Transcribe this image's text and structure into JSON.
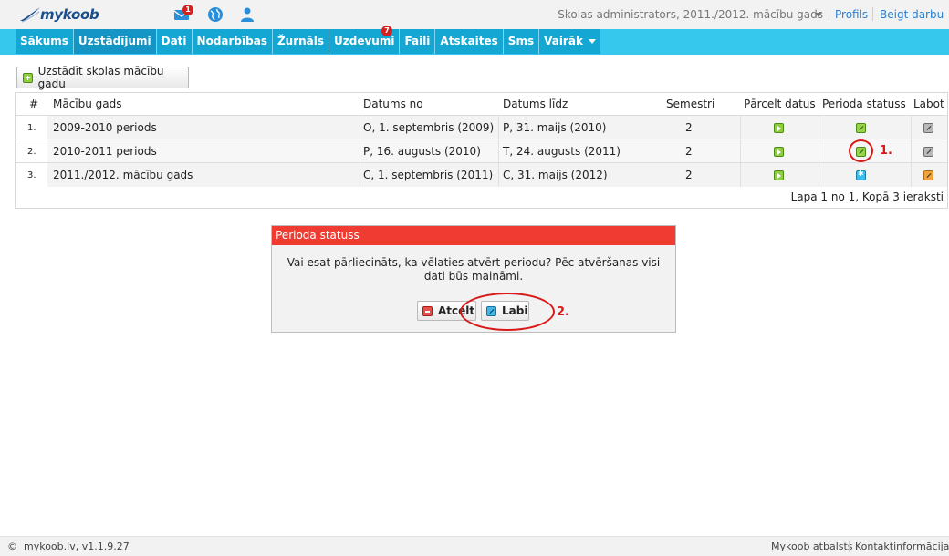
{
  "app": {
    "logo_text": "mykoob",
    "role_label": "Skolas administrators, 2011./2012. mācību gads",
    "links": {
      "profile": "Profils",
      "logout": "Beigt darbu"
    },
    "mail_badge": "1",
    "icons": [
      "envelope-icon",
      "globe-icon",
      "user-icon"
    ]
  },
  "nav": {
    "items": [
      "Sākums",
      "Uzstādījumi",
      "Dati",
      "Nodarbības",
      "Žurnāls",
      "Uzdevumi",
      "Faili",
      "Atskaites",
      "Sms",
      "Vairāk"
    ],
    "active": "Uzstādījumi",
    "files_badge": "7"
  },
  "toolbar": {
    "add_label": "Uzstādīt skolas mācību gadu"
  },
  "table": {
    "headers": [
      "#",
      "Mācību gads",
      "Datums no",
      "Datums līdz",
      "Semestri",
      "Pārcelt datus",
      "Perioda statuss",
      "Labot"
    ],
    "rows": [
      {
        "num": "1.",
        "name": "2009-2010 periods",
        "from": "O, 1. septembris (2009)",
        "to": "P, 31. maijs (2010)",
        "semesters": "2",
        "status": "check",
        "edit": "gray"
      },
      {
        "num": "2.",
        "name": "2010-2011 periods",
        "from": "P, 16. augusts (2010)",
        "to": "T, 24. augusts (2011)",
        "semesters": "2",
        "status": "check",
        "edit": "gray"
      },
      {
        "num": "3.",
        "name": "2011./2012. mācību gads",
        "from": "C, 1. septembris (2011)",
        "to": "C, 31. maijs (2012)",
        "semesters": "2",
        "status": "active",
        "edit": "orange"
      }
    ],
    "pager": "Lapa 1 no 1, Kopā 3 ieraksti"
  },
  "dialog": {
    "title": "Perioda statuss",
    "message": "Vai esat pārliecināts, ka vēlaties atvērt periodu? Pēc atvēršanas visi dati būs maināmi.",
    "cancel_label": "Atcelt",
    "ok_label": "Labi"
  },
  "annotations": {
    "step1": "1.",
    "step2": "2.",
    "color": "#d91a1a"
  },
  "footer": {
    "copyright_symbol": "©",
    "copyright": "mykoob.lv, v1.1.9.27",
    "support": "Mykoob atbalsts",
    "contacts": "Kontaktinformācija"
  },
  "colors": {
    "nav_bg": "#15a7d4",
    "nav_bar": "#37c8ee",
    "dialog_title": "#ef3b32",
    "link": "#2a7fcf"
  }
}
